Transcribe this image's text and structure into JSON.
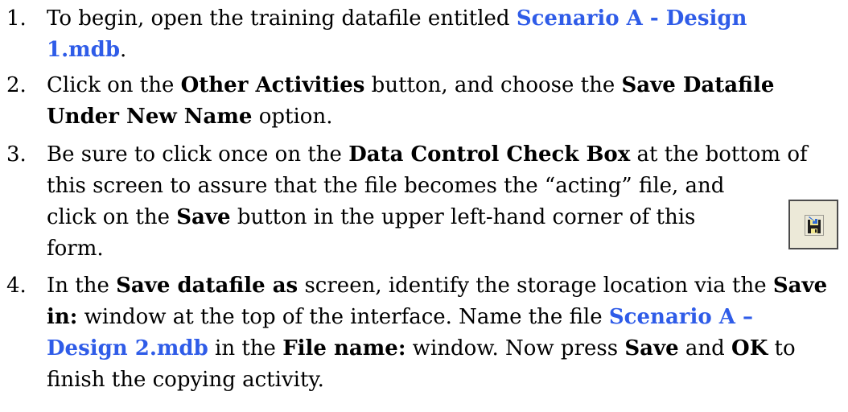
{
  "steps": [
    {
      "number": "1.",
      "lines": [
        {
          "t1": "To begin, open the training datafile entitled ",
          "l1": "Scenario A - Design"
        },
        {
          "l1": "1.mdb",
          "t1": "."
        }
      ]
    },
    {
      "number": "2.",
      "lines": [
        {
          "t1": "Click on the ",
          "b1": "Other Activities",
          "t2": " button, and choose the ",
          "b2": "Save Datafile"
        },
        {
          "b1": "Under New Name",
          "t1": " option."
        }
      ]
    },
    {
      "number": "3.",
      "lines": [
        {
          "t1": "Be sure to click once on the ",
          "b1": "Data Control Check Box",
          "t2": " at the bottom of"
        },
        {
          "t1": "this screen to assure that the file becomes the “acting” file, and"
        },
        {
          "t1": "click on the ",
          "b1": "Save",
          "t2": " button in the upper left-hand corner of this"
        },
        {
          "t1": "form."
        }
      ]
    },
    {
      "number": "4.",
      "lines": [
        {
          "t1": "In the ",
          "b1": "Save datafile as",
          "t2": " screen, identify the storage location via the ",
          "b2": "Save"
        },
        {
          "b1": "in:",
          "t1": " window at the top of the interface. Name the file ",
          "l1": "Scenario A –"
        },
        {
          "l1": "Design 2.mdb",
          "t1": " in the ",
          "b1": "File name:",
          "t2": " window. Now press ",
          "b2": "Save",
          "t3": " and ",
          "b3": "OK",
          "t4": " to"
        },
        {
          "t1": "finish the copying activity."
        }
      ]
    }
  ],
  "save_icon": {
    "icon": "floppy-disk-save-icon",
    "colors": {
      "frame": "#4b4b4b",
      "background": "#ece9d8",
      "disk": "#1c1c1c",
      "label": "#f0e68c",
      "arrow": "#2f6cd6"
    }
  }
}
